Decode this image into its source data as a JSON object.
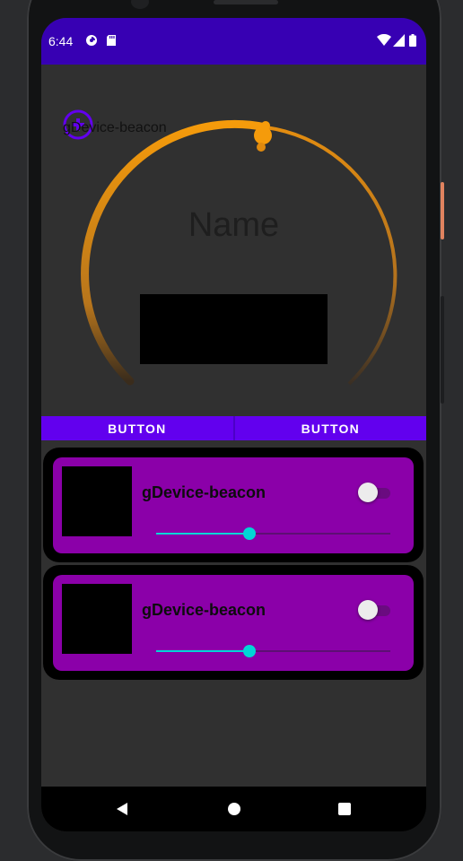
{
  "status_bar": {
    "time": "6:44",
    "background": "#3700b3"
  },
  "header": {
    "device_name": "gDevice-beacon",
    "name_label": "Name",
    "dial_color": "#f59b0b"
  },
  "buttons": [
    {
      "label": "BUTTON"
    },
    {
      "label": "BUTTON"
    }
  ],
  "devices": [
    {
      "name": "gDevice-beacon",
      "switch_on": false,
      "level": 0.4
    },
    {
      "name": "gDevice-beacon",
      "switch_on": false,
      "level": 0.4
    }
  ],
  "colors": {
    "accent": "#6200ee",
    "card": "#8b00a9",
    "slider": "#00d6d6"
  },
  "icons": {
    "add": "add-circle-icon",
    "back": "back-triangle-icon",
    "home": "home-circle-icon",
    "recents": "recents-square-icon"
  }
}
